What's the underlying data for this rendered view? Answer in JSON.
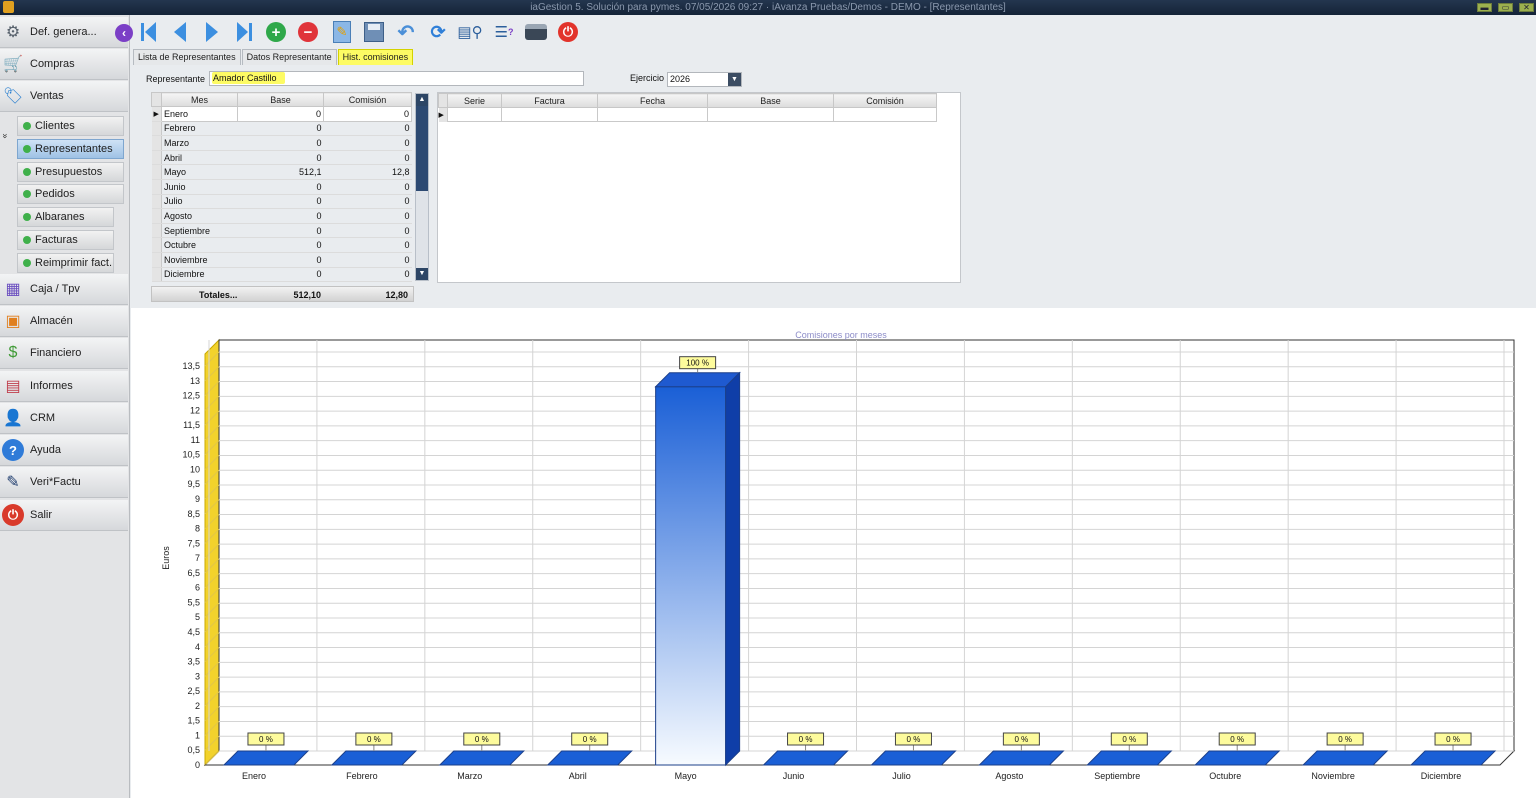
{
  "window": {
    "title": "iaGestion 5. Solución para pymes.  07/05/2026 09:27   ·  iAvanza Pruebas/Demos - DEMO - [Representantes]",
    "controls": [
      "▬",
      "▭",
      "✕"
    ]
  },
  "sidebar": {
    "items": [
      {
        "label": "Def. genera...",
        "icon": "gear-icon",
        "glyph": "⚙",
        "color": "#56606b"
      },
      {
        "label": "Compras",
        "icon": "cart-icon",
        "glyph": "🛒",
        "color": "#2f8d3d"
      },
      {
        "label": "Ventas",
        "icon": "sales-icon",
        "glyph": "🏷",
        "color": "#2a7fcf"
      },
      {
        "label": "Caja / Tpv",
        "icon": "cash-register-icon",
        "glyph": "▦",
        "color": "#6b4fc0"
      },
      {
        "label": "Almacén",
        "icon": "warehouse-icon",
        "glyph": "▣",
        "color": "#e07f1e"
      },
      {
        "label": "Financiero",
        "icon": "money-icon",
        "glyph": "$",
        "color": "#3f9a35"
      },
      {
        "label": "Informes",
        "icon": "report-icon",
        "glyph": "▤",
        "color": "#c0404e"
      },
      {
        "label": "CRM",
        "icon": "crm-user-icon",
        "glyph": "👤",
        "color": "#3a6ea5"
      },
      {
        "label": "Ayuda",
        "icon": "help-icon",
        "glyph": "?",
        "color": "#2f7bd8"
      },
      {
        "label": "Veri*Factu",
        "icon": "verifactu-logo-icon",
        "glyph": "✎",
        "color": "#1f3d6e"
      },
      {
        "label": "Salir",
        "icon": "power-icon",
        "glyph": "⏻",
        "color": "#d93a2b"
      }
    ],
    "ventas_subitems": [
      {
        "label": "Clientes",
        "active": false
      },
      {
        "label": "Representantes",
        "active": true
      },
      {
        "label": "Presupuestos",
        "active": false
      },
      {
        "label": "Pedidos",
        "active": false
      },
      {
        "label": "Albaranes",
        "active": false
      },
      {
        "label": "Facturas",
        "active": false
      },
      {
        "label": "Reimprimir fact.",
        "active": false
      }
    ]
  },
  "toolbar": {
    "buttons": [
      "collapse-sidebar-icon",
      "first-record-icon",
      "previous-record-icon",
      "next-record-icon",
      "last-record-icon",
      "add-icon",
      "delete-icon",
      "edit-icon",
      "save-icon",
      "undo-icon",
      "refresh-icon",
      "search-icon",
      "list-help-icon",
      "print-icon",
      "close-icon"
    ]
  },
  "tabs": [
    {
      "label": "Lista de Representantes",
      "active": false
    },
    {
      "label": "Datos Representante",
      "active": false
    },
    {
      "label": "Hist. comisiones",
      "active": true
    }
  ],
  "form": {
    "representante_label": "Representante",
    "representante_value": "Amador Castillo",
    "ejercicio_label": "Ejercicio",
    "ejercicio_value": "2026"
  },
  "months_grid": {
    "headers": [
      "Mes",
      "Base",
      "Comisión"
    ],
    "rows": [
      {
        "mes": "Enero",
        "base": "0",
        "comision": "0"
      },
      {
        "mes": "Febrero",
        "base": "0",
        "comision": "0"
      },
      {
        "mes": "Marzo",
        "base": "0",
        "comision": "0"
      },
      {
        "mes": "Abril",
        "base": "0",
        "comision": "0"
      },
      {
        "mes": "Mayo",
        "base": "512,1",
        "comision": "12,8"
      },
      {
        "mes": "Junio",
        "base": "0",
        "comision": "0"
      },
      {
        "mes": "Julio",
        "base": "0",
        "comision": "0"
      },
      {
        "mes": "Agosto",
        "base": "0",
        "comision": "0"
      },
      {
        "mes": "Septiembre",
        "base": "0",
        "comision": "0"
      },
      {
        "mes": "Octubre",
        "base": "0",
        "comision": "0"
      },
      {
        "mes": "Noviembre",
        "base": "0",
        "comision": "0"
      },
      {
        "mes": "Diciembre",
        "base": "0",
        "comision": "0"
      }
    ],
    "totals": {
      "label": "Totales...",
      "base": "512,10",
      "comision": "12,80"
    }
  },
  "invoices_grid": {
    "headers": [
      "Serie",
      "Factura",
      "Fecha",
      "Base",
      "Comisión"
    ]
  },
  "chart_data": {
    "type": "bar",
    "title": "Comisiones por meses",
    "ylabel": "Euros",
    "xlabel": "",
    "categories": [
      "Enero",
      "Febrero",
      "Marzo",
      "Abril",
      "Mayo",
      "Junio",
      "Julio",
      "Agosto",
      "Septiembre",
      "Octubre",
      "Noviembre",
      "Diciembre"
    ],
    "values": [
      0,
      0,
      0,
      0,
      12.8,
      0,
      0,
      0,
      0,
      0,
      0,
      0
    ],
    "data_labels": [
      "0 %",
      "0 %",
      "0 %",
      "0 %",
      "100 %",
      "0 %",
      "0 %",
      "0 %",
      "0 %",
      "0 %",
      "0 %",
      "0 %"
    ],
    "ylim": [
      0,
      13.5
    ],
    "yticks": [
      "0",
      "0,5",
      "1",
      "1,5",
      "2",
      "2,5",
      "3",
      "3,5",
      "4",
      "4,5",
      "5",
      "5,5",
      "6",
      "6,5",
      "7",
      "7,5",
      "8",
      "8,5",
      "9",
      "9,5",
      "10",
      "10,5",
      "11",
      "11,5",
      "12",
      "12,5",
      "13",
      "13,5"
    ],
    "grid": true,
    "bar_color": "#1a5fd6",
    "label_bg": "#fdfb9c",
    "wall_color": "#f2d22c"
  }
}
